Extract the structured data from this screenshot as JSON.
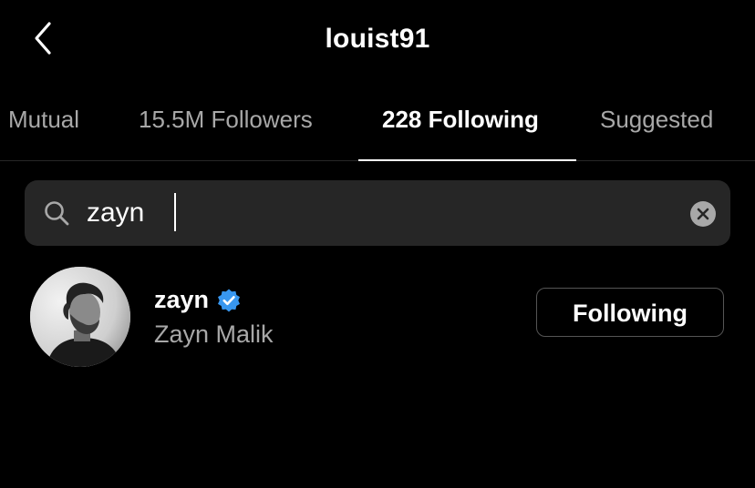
{
  "header": {
    "title": "louist91"
  },
  "tabs": [
    {
      "label": "Mutual"
    },
    {
      "label": "15.5M Followers"
    },
    {
      "label": "228 Following"
    },
    {
      "label": "Suggested"
    }
  ],
  "active_tab": "228 Following",
  "search": {
    "value": "zayn"
  },
  "results": [
    {
      "username": "zayn",
      "full_name": "Zayn Malik",
      "verified": true,
      "button_label": "Following"
    }
  ],
  "colors": {
    "background": "#000000",
    "search_bg": "#262626",
    "secondary_text": "#a8a8a8",
    "verified_blue": "#3897f0"
  }
}
